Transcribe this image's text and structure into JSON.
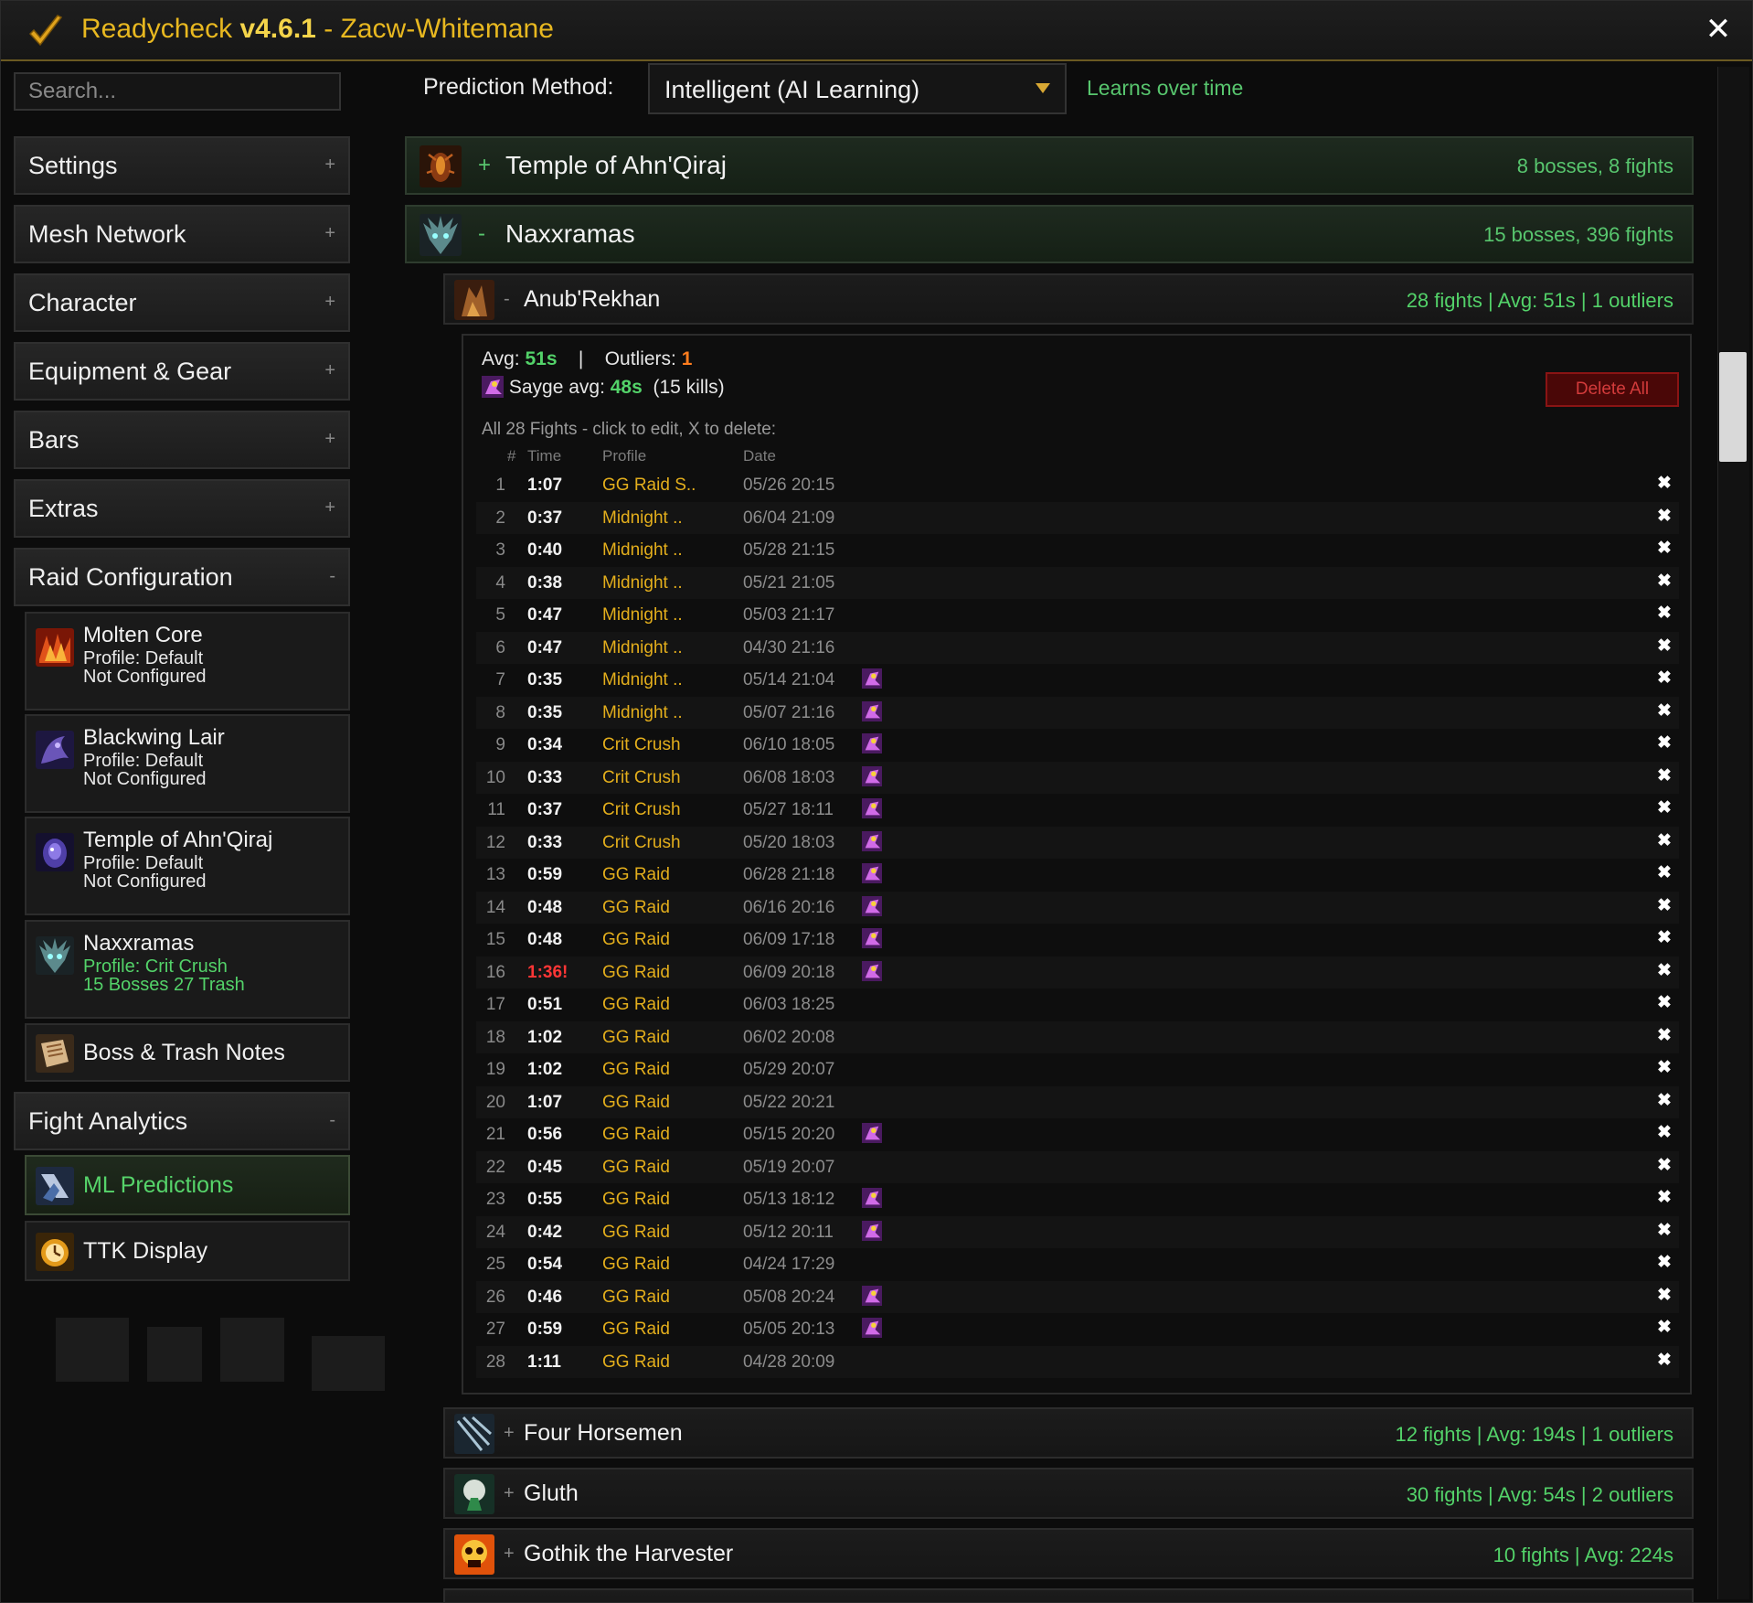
{
  "window": {
    "title_prefix": "Readycheck ",
    "version": "v4.6.1",
    "title_suffix": " - Zacw-Whitemane",
    "close": "✕"
  },
  "sidebar": {
    "search_placeholder": "Search...",
    "sections": [
      {
        "label": "Settings",
        "toggle": "+"
      },
      {
        "label": "Mesh Network",
        "toggle": "+"
      },
      {
        "label": "Character",
        "toggle": "+"
      },
      {
        "label": "Equipment & Gear",
        "toggle": "+"
      },
      {
        "label": "Bars",
        "toggle": "+"
      },
      {
        "label": "Extras",
        "toggle": "+"
      },
      {
        "label": "Raid Configuration",
        "toggle": "-"
      },
      {
        "label": "Fight Analytics",
        "toggle": "-"
      }
    ],
    "raids": [
      {
        "name": "Molten Core",
        "line2": "Profile: Default",
        "line3": "Not Configured"
      },
      {
        "name": "Blackwing Lair",
        "line2": "Profile: Default",
        "line3": "Not Configured"
      },
      {
        "name": "Temple of Ahn'Qiraj",
        "line2": "Profile: Default",
        "line3": "Not Configured"
      },
      {
        "name": "Naxxramas",
        "line2": "Profile: Crit Crush",
        "line3": "15 Bosses  27 Trash"
      }
    ],
    "notes": "Boss & Trash Notes",
    "analytics": [
      "ML Predictions",
      "TTK Display"
    ]
  },
  "main": {
    "prediction_label": "Prediction Method:",
    "prediction_value": "Intelligent (AI Learning)",
    "prediction_hint": "Learns over time",
    "raids": [
      {
        "toggle": "+",
        "name": "Temple of Ahn'Qiraj",
        "stats": "8 bosses, 8 fights"
      },
      {
        "toggle": "-",
        "name": "Naxxramas",
        "stats": "15 bosses, 396 fights"
      }
    ],
    "bosses": [
      {
        "toggle": "-",
        "name": "Anub'Rekhan",
        "stats": "28 fights  |  Avg: 51s  |  1 outliers"
      },
      {
        "toggle": "+",
        "name": "Four Horsemen",
        "stats": "12 fights  |  Avg: 194s  |  1 outliers"
      },
      {
        "toggle": "+",
        "name": "Gluth",
        "stats": "30 fights  |  Avg: 54s  |  2 outliers"
      },
      {
        "toggle": "+",
        "name": "Gothik the Harvester",
        "stats": "10 fights  |  Avg: 224s"
      }
    ],
    "detail": {
      "avg_label": "Avg: ",
      "avg_value": "51s",
      "sep": "|",
      "outliers_label": "Outliers: ",
      "outliers_value": "1",
      "sayge_label": "Sayge avg: ",
      "sayge_value": "48s",
      "sayge_kills": "(15 kills)",
      "delete_all": "Delete All",
      "all_fights": "All 28 Fights - click to edit, X to delete:",
      "headers": {
        "num": "#",
        "time": "Time",
        "profile": "Profile",
        "date": "Date"
      },
      "delete_glyph": "✖",
      "fights": [
        {
          "n": "1",
          "time": "1:07",
          "profile": "GG Raid S..",
          "date": "05/26 20:15",
          "sayge": false
        },
        {
          "n": "2",
          "time": "0:37",
          "profile": "Midnight ..",
          "date": "06/04 21:09",
          "sayge": false
        },
        {
          "n": "3",
          "time": "0:40",
          "profile": "Midnight ..",
          "date": "05/28 21:15",
          "sayge": false
        },
        {
          "n": "4",
          "time": "0:38",
          "profile": "Midnight ..",
          "date": "05/21 21:05",
          "sayge": false
        },
        {
          "n": "5",
          "time": "0:47",
          "profile": "Midnight ..",
          "date": "05/03 21:17",
          "sayge": false
        },
        {
          "n": "6",
          "time": "0:47",
          "profile": "Midnight ..",
          "date": "04/30 21:16",
          "sayge": false
        },
        {
          "n": "7",
          "time": "0:35",
          "profile": "Midnight ..",
          "date": "05/14 21:04",
          "sayge": true
        },
        {
          "n": "8",
          "time": "0:35",
          "profile": "Midnight ..",
          "date": "05/07 21:16",
          "sayge": true
        },
        {
          "n": "9",
          "time": "0:34",
          "profile": "Crit Crush",
          "date": "06/10 18:05",
          "sayge": true
        },
        {
          "n": "10",
          "time": "0:33",
          "profile": "Crit Crush",
          "date": "06/08 18:03",
          "sayge": true
        },
        {
          "n": "11",
          "time": "0:37",
          "profile": "Crit Crush",
          "date": "05/27 18:11",
          "sayge": true
        },
        {
          "n": "12",
          "time": "0:33",
          "profile": "Crit Crush",
          "date": "05/20 18:03",
          "sayge": true
        },
        {
          "n": "13",
          "time": "0:59",
          "profile": "GG Raid",
          "date": "06/28 21:18",
          "sayge": true
        },
        {
          "n": "14",
          "time": "0:48",
          "profile": "GG Raid",
          "date": "06/16 20:16",
          "sayge": true
        },
        {
          "n": "15",
          "time": "0:48",
          "profile": "GG Raid",
          "date": "06/09 17:18",
          "sayge": true
        },
        {
          "n": "16",
          "time": "1:36!",
          "profile": "GG Raid",
          "date": "06/09 20:18",
          "sayge": true,
          "outlier": true
        },
        {
          "n": "17",
          "time": "0:51",
          "profile": "GG Raid",
          "date": "06/03 18:25",
          "sayge": false
        },
        {
          "n": "18",
          "time": "1:02",
          "profile": "GG Raid",
          "date": "06/02 20:08",
          "sayge": false
        },
        {
          "n": "19",
          "time": "1:02",
          "profile": "GG Raid",
          "date": "05/29 20:07",
          "sayge": false
        },
        {
          "n": "20",
          "time": "1:07",
          "profile": "GG Raid",
          "date": "05/22 20:21",
          "sayge": false
        },
        {
          "n": "21",
          "time": "0:56",
          "profile": "GG Raid",
          "date": "05/15 20:20",
          "sayge": true
        },
        {
          "n": "22",
          "time": "0:45",
          "profile": "GG Raid",
          "date": "05/19 20:07",
          "sayge": false
        },
        {
          "n": "23",
          "time": "0:55",
          "profile": "GG Raid",
          "date": "05/13 18:12",
          "sayge": true
        },
        {
          "n": "24",
          "time": "0:42",
          "profile": "GG Raid",
          "date": "05/12 20:11",
          "sayge": true
        },
        {
          "n": "25",
          "time": "0:54",
          "profile": "GG Raid",
          "date": "04/24 17:29",
          "sayge": false
        },
        {
          "n": "26",
          "time": "0:46",
          "profile": "GG Raid",
          "date": "05/08 20:24",
          "sayge": true
        },
        {
          "n": "27",
          "time": "0:59",
          "profile": "GG Raid",
          "date": "05/05 20:13",
          "sayge": true
        },
        {
          "n": "28",
          "time": "1:11",
          "profile": "GG Raid",
          "date": "04/28 20:09",
          "sayge": false
        }
      ]
    }
  },
  "colors": {
    "accent_gold": "#e8b820",
    "positive_green": "#53d269",
    "outlier_orange": "#ff7d1e",
    "danger_red": "#d33b3b",
    "profile_gold": "#e3ae1c"
  }
}
